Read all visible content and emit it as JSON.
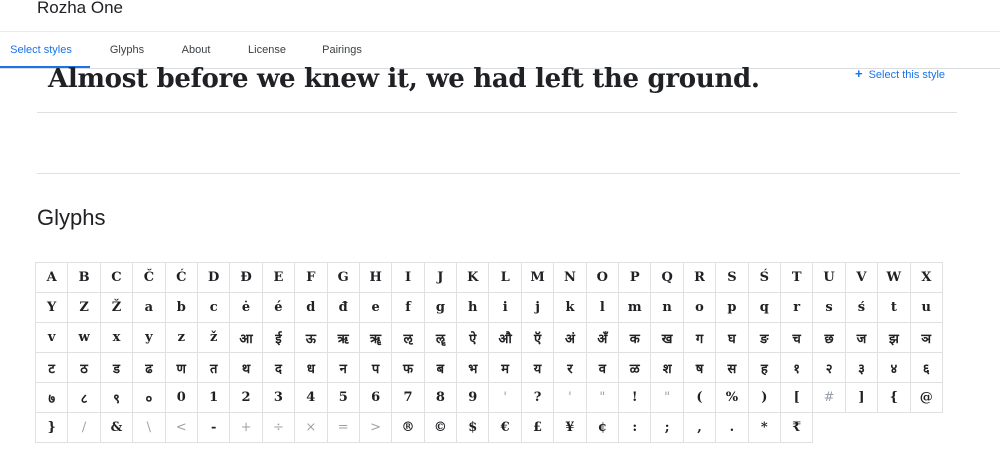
{
  "font_name": "Rozha One",
  "tabs": [
    "Select styles",
    "Glyphs",
    "About",
    "License",
    "Pairings"
  ],
  "sample_text": "Almost before we knew it, we had left the ground.",
  "select_style_label": "Select this style",
  "glyphs_heading": "Glyphs",
  "glyph_rows": [
    [
      "A",
      "B",
      "C",
      "Č",
      "Ć",
      "D",
      "Đ",
      "E",
      "F",
      "G",
      "H",
      "I",
      "J",
      "K",
      "L",
      "M",
      "N",
      "O",
      "P",
      "Q",
      "R",
      "S",
      "Ś",
      "T",
      "U",
      "V",
      "W",
      "X"
    ],
    [
      "Y",
      "Z",
      "Ž",
      "a",
      "b",
      "c",
      "ė",
      "é",
      "d",
      "đ",
      "e",
      "f",
      "g",
      "h",
      "i",
      "j",
      "k",
      "l",
      "m",
      "n",
      "o",
      "p",
      "q",
      "r",
      "s",
      "ś",
      "t",
      "u"
    ],
    [
      "v",
      "w",
      "x",
      "y",
      "z",
      "ž",
      "आ",
      "ई",
      "ऊ",
      "ऋ",
      "ॠ",
      "ऌ",
      "ॡ",
      "ऐ",
      "औ",
      "ऍ",
      "अं",
      "अँ",
      "क",
      "ख",
      "ग",
      "घ",
      "ङ",
      "च",
      "छ",
      "ज",
      "झ",
      "ञ"
    ],
    [
      "ट",
      "ठ",
      "ड",
      "ढ",
      "ण",
      "त",
      "थ",
      "द",
      "ध",
      "न",
      "प",
      "फ",
      "ब",
      "भ",
      "म",
      "य",
      "र",
      "व",
      "ळ",
      "श",
      "ष",
      "स",
      "ह",
      "१",
      "२",
      "३",
      "४",
      "६"
    ],
    [
      "७",
      "८",
      "९",
      "०",
      "0",
      "1",
      "2",
      "3",
      "4",
      "5",
      "6",
      "7",
      "8",
      "9",
      "'",
      "?",
      "'",
      "\"",
      "!",
      "\"",
      "(",
      "%",
      ")",
      "[",
      "#",
      "]",
      "{",
      "@"
    ],
    [
      "}",
      "/",
      "&",
      "\\",
      "<",
      "-",
      "+",
      "÷",
      "×",
      "=",
      ">",
      "®",
      "©",
      "$",
      "€",
      "£",
      "¥",
      "¢",
      ":",
      ";",
      ",",
      ".",
      "*",
      "₹"
    ]
  ],
  "light_glyphs": [
    "/",
    "\\",
    "<",
    "+",
    "÷",
    "×",
    "=",
    ">",
    "#",
    "'",
    "\""
  ]
}
